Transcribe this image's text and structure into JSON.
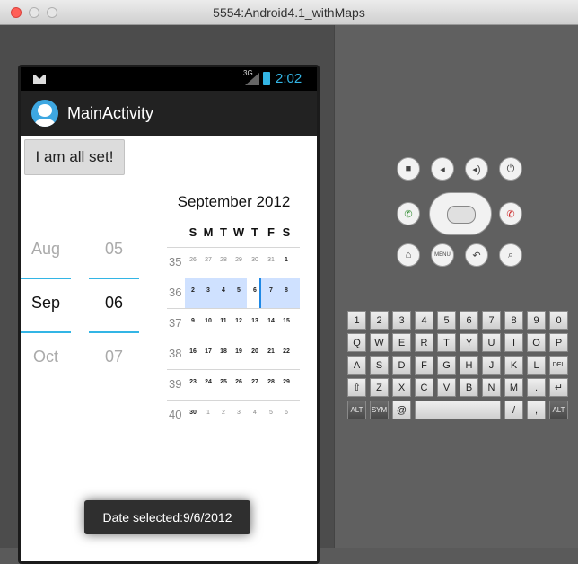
{
  "window": {
    "title": "5554:Android4.1_withMaps"
  },
  "statusbar": {
    "network": "3G",
    "time": "2:02"
  },
  "actionbar": {
    "title": "MainActivity"
  },
  "button": {
    "label": "I am all set!"
  },
  "date_picker": {
    "month": {
      "prev": "Aug",
      "selected": "Sep",
      "next": "Oct"
    },
    "day": {
      "prev": "05",
      "selected": "06",
      "next": "07"
    }
  },
  "calendar": {
    "title": "September 2012",
    "weekdays": [
      "S",
      "M",
      "T",
      "W",
      "T",
      "F",
      "S"
    ],
    "rows": [
      {
        "week": "35",
        "days": [
          "26",
          "27",
          "28",
          "29",
          "30",
          "31",
          "1"
        ]
      },
      {
        "week": "36",
        "days": [
          "2",
          "3",
          "4",
          "5",
          "6",
          "7",
          "8"
        ]
      },
      {
        "week": "37",
        "days": [
          "9",
          "10",
          "11",
          "12",
          "13",
          "14",
          "15"
        ]
      },
      {
        "week": "38",
        "days": [
          "16",
          "17",
          "18",
          "19",
          "20",
          "21",
          "22"
        ]
      },
      {
        "week": "39",
        "days": [
          "23",
          "24",
          "25",
          "26",
          "27",
          "28",
          "29"
        ]
      },
      {
        "week": "40",
        "days": [
          "30",
          "1",
          "2",
          "3",
          "4",
          "5",
          "6"
        ]
      }
    ]
  },
  "toast": {
    "text": "Date selected:9/6/2012"
  },
  "controls": {
    "camera_icon": "camera-icon",
    "volume_down_icon": "volume-down-icon",
    "volume_up_icon": "volume-up-icon",
    "power_icon": "power-icon",
    "call_icon": "call-icon",
    "end_call_icon": "end-call-icon",
    "home_icon": "home-icon",
    "menu_label": "MENU",
    "back_icon": "back-icon",
    "search_icon": "search-icon"
  },
  "keyboard": {
    "row1": [
      "1",
      "2",
      "3",
      "4",
      "5",
      "6",
      "7",
      "8",
      "9",
      "0"
    ],
    "row2": [
      "Q",
      "W",
      "E",
      "R",
      "T",
      "Y",
      "U",
      "I",
      "O",
      "P"
    ],
    "row3": [
      "A",
      "S",
      "D",
      "F",
      "G",
      "H",
      "J",
      "K",
      "L",
      "DEL"
    ],
    "row4": [
      "⇧",
      "Z",
      "X",
      "C",
      "V",
      "B",
      "N",
      "M",
      ".",
      "↵"
    ],
    "row5": [
      "ALT",
      "SYM",
      "@",
      "",
      "/",
      ",",
      "ALT"
    ]
  }
}
